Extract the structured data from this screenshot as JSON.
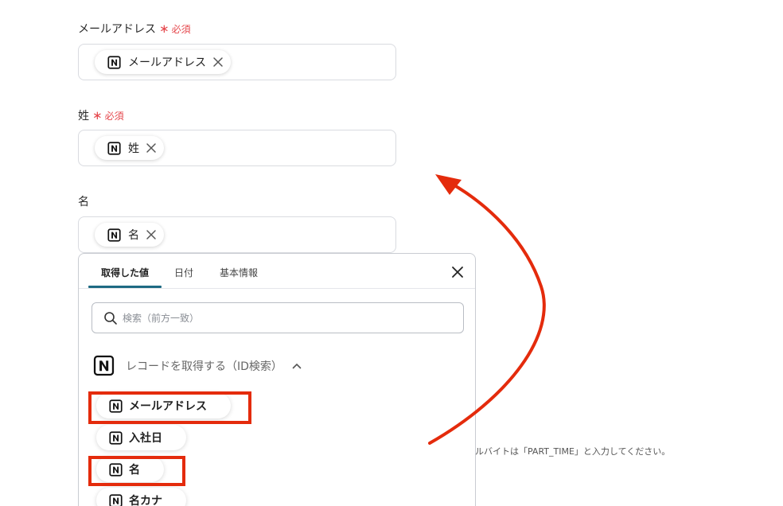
{
  "form": {
    "required_mark": "∗",
    "required_text": "必須",
    "fields": [
      {
        "label": "メールアドレス",
        "required": true,
        "chip_label": "メールアドレス"
      },
      {
        "label": "姓",
        "required": true,
        "chip_label": "姓"
      },
      {
        "label": "名",
        "required": false,
        "chip_label": "名"
      }
    ]
  },
  "popover": {
    "tabs": [
      {
        "label": "取得した値",
        "active": true
      },
      {
        "label": "日付",
        "active": false
      },
      {
        "label": "基本情報",
        "active": false
      }
    ],
    "search_placeholder": "検索（前方一致）",
    "group_title": "レコードを取得する（ID検索）",
    "items": [
      {
        "label": "メールアドレス",
        "highlighted": true
      },
      {
        "label": "入社日",
        "highlighted": false
      },
      {
        "label": "名",
        "highlighted": true
      },
      {
        "label": "名カナ",
        "highlighted": false
      }
    ]
  },
  "helper_text": "ルバイトは「PART_TIME」と入力してください。",
  "colors": {
    "required": "#e5484d",
    "tab_underline": "#1e6a83",
    "highlight": "#e42b0c",
    "arrow": "#e42b0c"
  },
  "icons": [
    "notion-icon",
    "close-icon",
    "search-icon",
    "chevron-up-icon",
    "curved-arrow"
  ]
}
